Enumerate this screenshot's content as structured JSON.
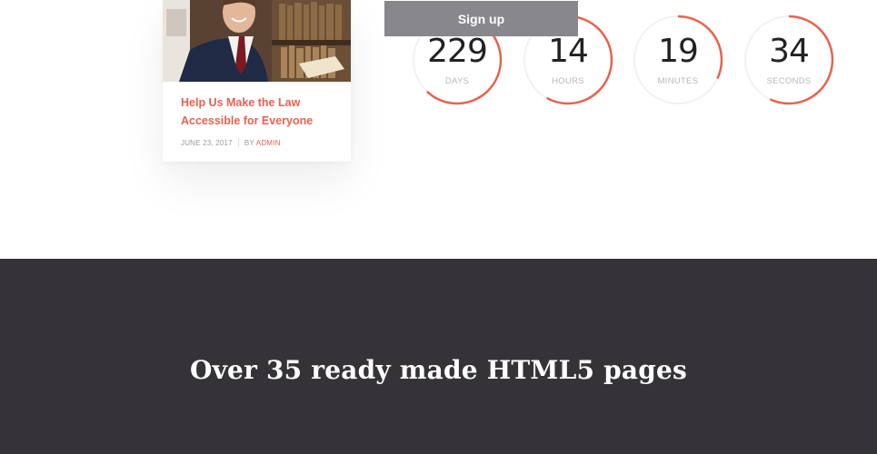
{
  "blog_card": {
    "title": "Help Us Make the Law Accessible for Everyone",
    "date": "JUNE 23, 2017",
    "by_prefix": "BY",
    "author": "ADMIN",
    "accent_color": "#e8624f"
  },
  "signup": {
    "label": "Sign up"
  },
  "countdown": {
    "ring_color": "#e8624f",
    "items": [
      {
        "value": "229",
        "label": "DAYS",
        "fraction": 0.62
      },
      {
        "value": "14",
        "label": "HOURS",
        "fraction": 0.58
      },
      {
        "value": "19",
        "label": "MINUTES",
        "fraction": 0.32
      },
      {
        "value": "34",
        "label": "SECONDS",
        "fraction": 0.57
      }
    ]
  },
  "band": {
    "heading": "Over 35 ready made HTML5 pages",
    "background": "#363338"
  }
}
